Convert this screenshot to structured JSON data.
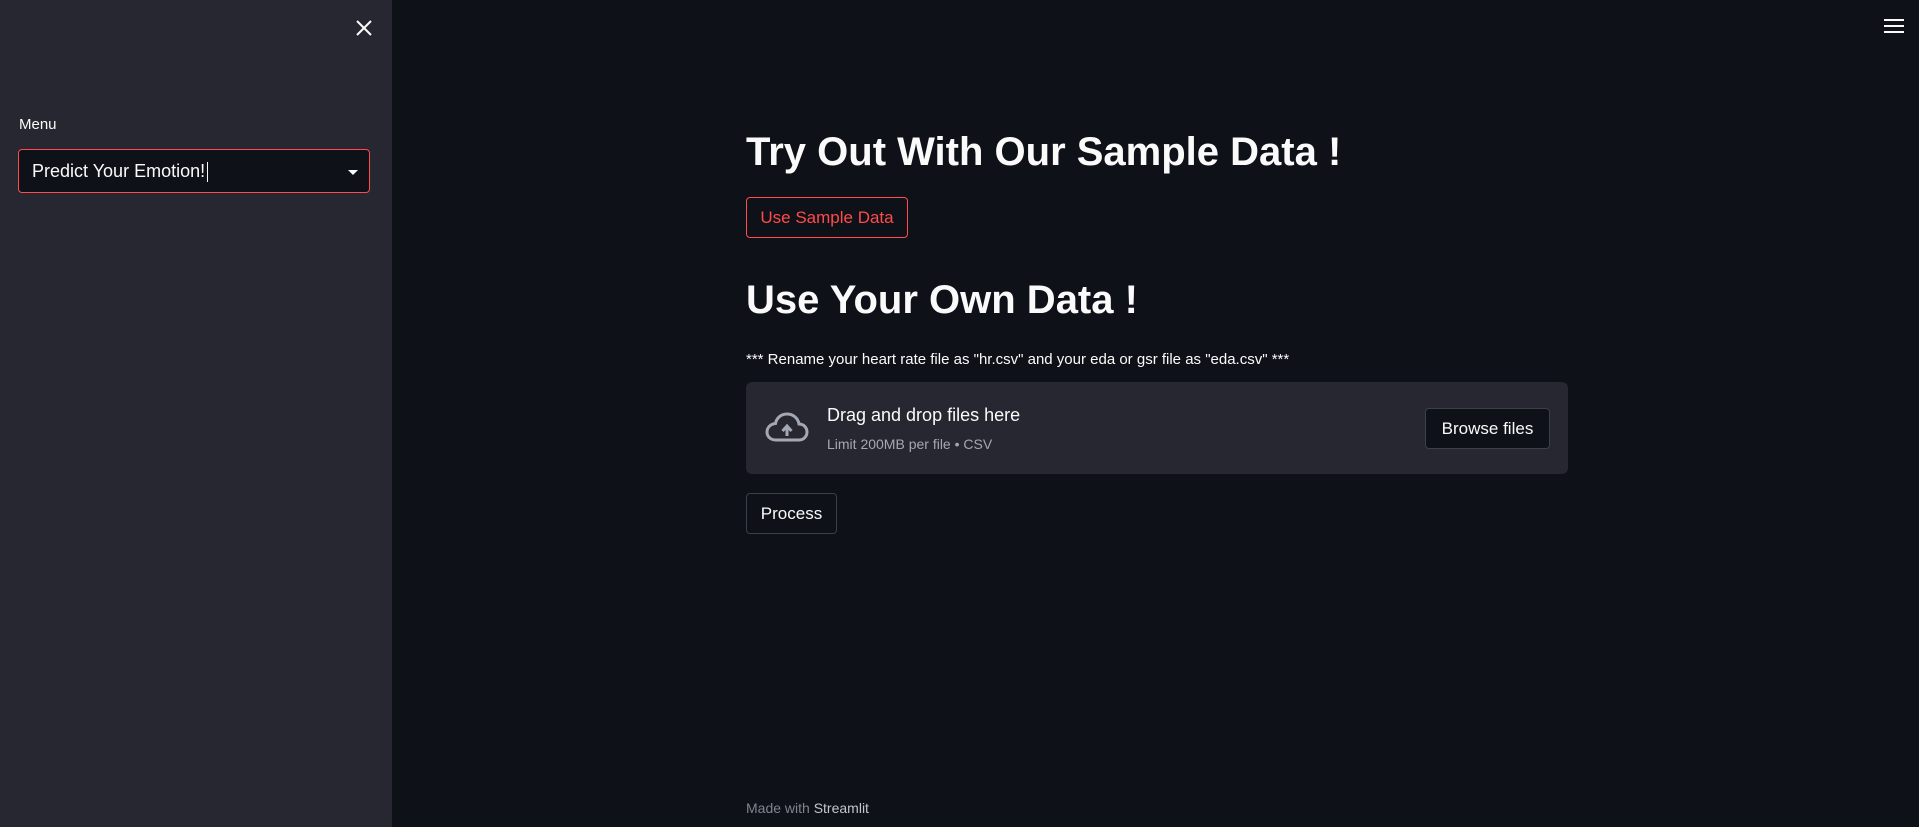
{
  "sidebar": {
    "menu_label": "Menu",
    "select_value": "Predict Your Emotion!"
  },
  "main": {
    "sample_heading": "Try Out With Our Sample Data !",
    "sample_button": "Use Sample Data",
    "own_heading": "Use Your Own Data !",
    "note": "*** Rename your heart rate file as \"hr.csv\" and your eda or gsr file as \"eda.csv\" ***",
    "uploader": {
      "title": "Drag and drop files here",
      "limit": "Limit 200MB per file • CSV",
      "browse_button": "Browse files"
    },
    "process_button": "Process"
  },
  "footer": {
    "made_with": "Made with",
    "brand": "Streamlit"
  },
  "colors": {
    "accent": "#ff4b4b",
    "background": "#0e1117",
    "sidebar_bg": "#262730"
  },
  "icons": {
    "close": "close-icon",
    "menu": "hamburger-menu-icon",
    "dropdown": "chevron-down-icon",
    "upload": "cloud-upload-icon"
  }
}
